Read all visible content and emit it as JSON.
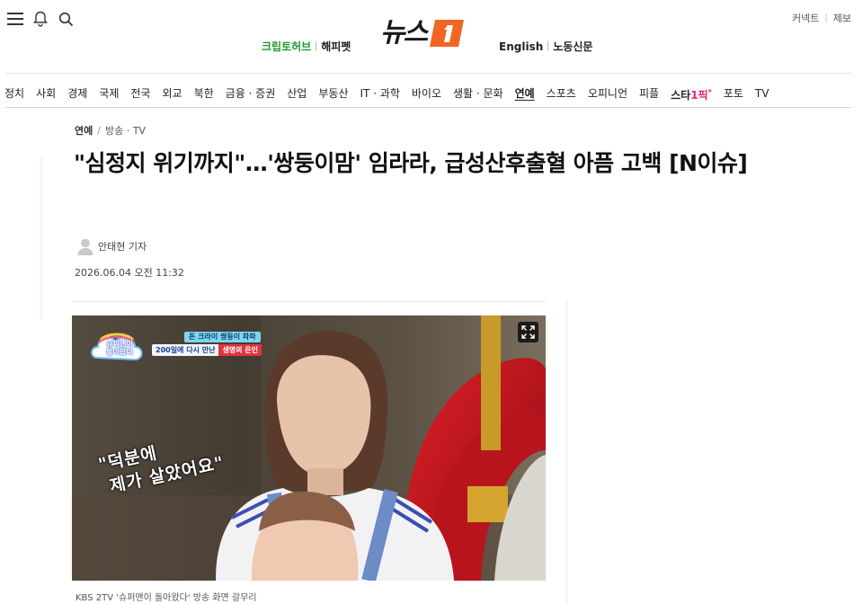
{
  "header": {
    "logo_text": "뉴스",
    "logo_mark": "1",
    "links_left": [
      "크립토허브",
      "해피펫"
    ],
    "links_right": [
      "English",
      "노동신문"
    ],
    "utility": [
      "커넥트",
      "제보"
    ],
    "icons": [
      "menu-icon",
      "bell-icon",
      "search-icon"
    ]
  },
  "nav": {
    "items": [
      "정치",
      "사회",
      "경제",
      "국제",
      "전국",
      "외교",
      "북한",
      "금융 · 증권",
      "산업",
      "부동산",
      "IT · 과학",
      "바이오",
      "생활 · 문화",
      "연예",
      "스포츠",
      "오피니언",
      "피플",
      "스타",
      "포토",
      "TV"
    ],
    "star_suffix": "1픽",
    "star_mark": "*",
    "active": "연예"
  },
  "article": {
    "breadcrumb": {
      "section": "연예",
      "separator": "/",
      "category": "방송 · TV"
    },
    "title": "\"심정지 위기까지\"…'쌍둥이맘' 임라라, 급성산후출혈 아픔 고백 [N이슈]",
    "author": "안태현 기자",
    "datetime": "2026.06.04 오전 11:32",
    "photo": {
      "show_logo": "슈퍼맨이 돌아왔다",
      "caption_top": "돈 크라이 쌍둥이 파파",
      "caption_bottom_left": "200일에 다시 만난",
      "caption_bottom_right": "생명의 은인",
      "subtitle": "\"덕분에\n 제가 살았어요\"",
      "caption": "KBS 2TV '슈퍼맨이 돌아왔다' 방송 화면 갈무리"
    }
  },
  "colors": {
    "brand_orange": "#f26522",
    "crypto_green": "#1f9a2c",
    "star_pink": "#e1257a"
  }
}
